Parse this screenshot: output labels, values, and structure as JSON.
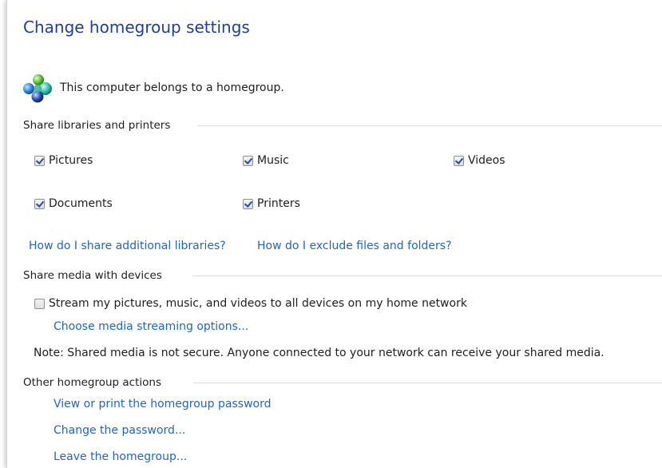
{
  "page": {
    "title": "Change homegroup settings",
    "status_text": "This computer belongs to a homegroup."
  },
  "share_libraries": {
    "heading": "Share libraries and printers",
    "items": [
      {
        "label": "Pictures",
        "checked": true
      },
      {
        "label": "Music",
        "checked": true
      },
      {
        "label": "Videos",
        "checked": true
      },
      {
        "label": "Documents",
        "checked": true
      },
      {
        "label": "Printers",
        "checked": true
      }
    ],
    "links": [
      "How do I share additional libraries?",
      "How do I exclude files and folders?"
    ]
  },
  "share_media": {
    "heading": "Share media with devices",
    "stream_label": "Stream my pictures, music, and videos to all devices on my home network",
    "stream_checked": false,
    "options_link": "Choose media streaming options...",
    "note": "Note: Shared media is not secure. Anyone connected to your network can receive your shared media."
  },
  "other_actions": {
    "heading": "Other homegroup actions",
    "links": [
      "View or print the homegroup password",
      "Change the password...",
      "Leave the homegroup..."
    ]
  },
  "colors": {
    "title": "#1e3f99",
    "link": "#1f66c2",
    "text": "#1e1e1e"
  }
}
